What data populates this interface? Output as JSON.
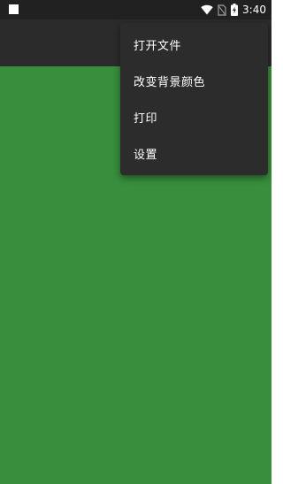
{
  "status_bar": {
    "time": "3:40",
    "icons": [
      "notification-square-icon",
      "wifi-icon",
      "no-sim-icon",
      "battery-charging-icon"
    ]
  },
  "colors": {
    "background": "#388e3c",
    "app_bar": "#2b2b2b",
    "status_bar": "#212121",
    "menu": "#2c2c2c",
    "menu_text": "#ffffff"
  },
  "menu": {
    "items": [
      {
        "label": "打开文件"
      },
      {
        "label": "改变背景颜色"
      },
      {
        "label": "打印"
      },
      {
        "label": "设置"
      }
    ]
  }
}
